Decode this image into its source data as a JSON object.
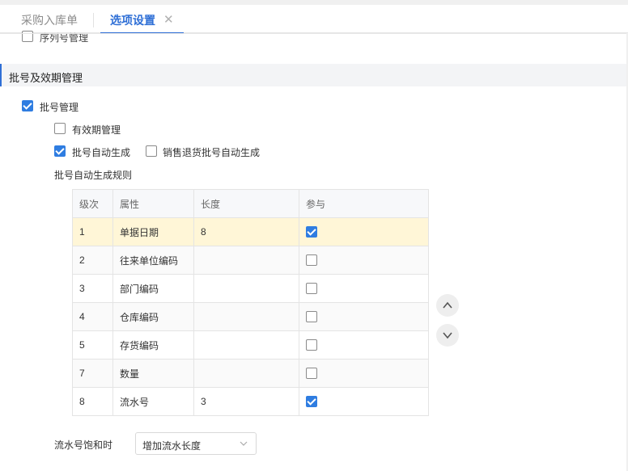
{
  "tabs": [
    {
      "label": "采购入库单",
      "active": false
    },
    {
      "label": "选项设置",
      "active": true,
      "close": "✕"
    }
  ],
  "serial_mgmt": {
    "label": "序列号管理",
    "checked": false
  },
  "section": {
    "title": "批号及效期管理"
  },
  "batch_mgmt": {
    "label": "批号管理",
    "checked": true
  },
  "expiry_mgmt": {
    "label": "有效期管理",
    "checked": false
  },
  "auto_gen": {
    "label": "批号自动生成",
    "checked": true
  },
  "return_auto_gen": {
    "label": "销售退货批号自动生成",
    "checked": false
  },
  "rules_title": "批号自动生成规则",
  "grid": {
    "headers": [
      "级次",
      "属性",
      "长度",
      "参与"
    ],
    "rows": [
      {
        "level": "1",
        "attr": "单据日期",
        "length": "8",
        "participate": true
      },
      {
        "level": "2",
        "attr": "往来单位编码",
        "length": "",
        "participate": false
      },
      {
        "level": "3",
        "attr": "部门编码",
        "length": "",
        "participate": false
      },
      {
        "level": "4",
        "attr": "仓库编码",
        "length": "",
        "participate": false
      },
      {
        "level": "5",
        "attr": "存货编码",
        "length": "",
        "participate": false
      },
      {
        "level": "7",
        "attr": "数量",
        "length": "",
        "participate": false
      },
      {
        "level": "8",
        "attr": "流水号",
        "length": "3",
        "participate": true
      }
    ]
  },
  "move_up_icon": "chevron-up-icon",
  "move_down_icon": "chevron-down-icon",
  "saturation": {
    "label": "流水号饱和时",
    "value": "增加流水长度"
  },
  "colors": {
    "accent": "#2f6fd6",
    "checkbox": "#2f7de1",
    "selected_row": "#fff6d7"
  }
}
